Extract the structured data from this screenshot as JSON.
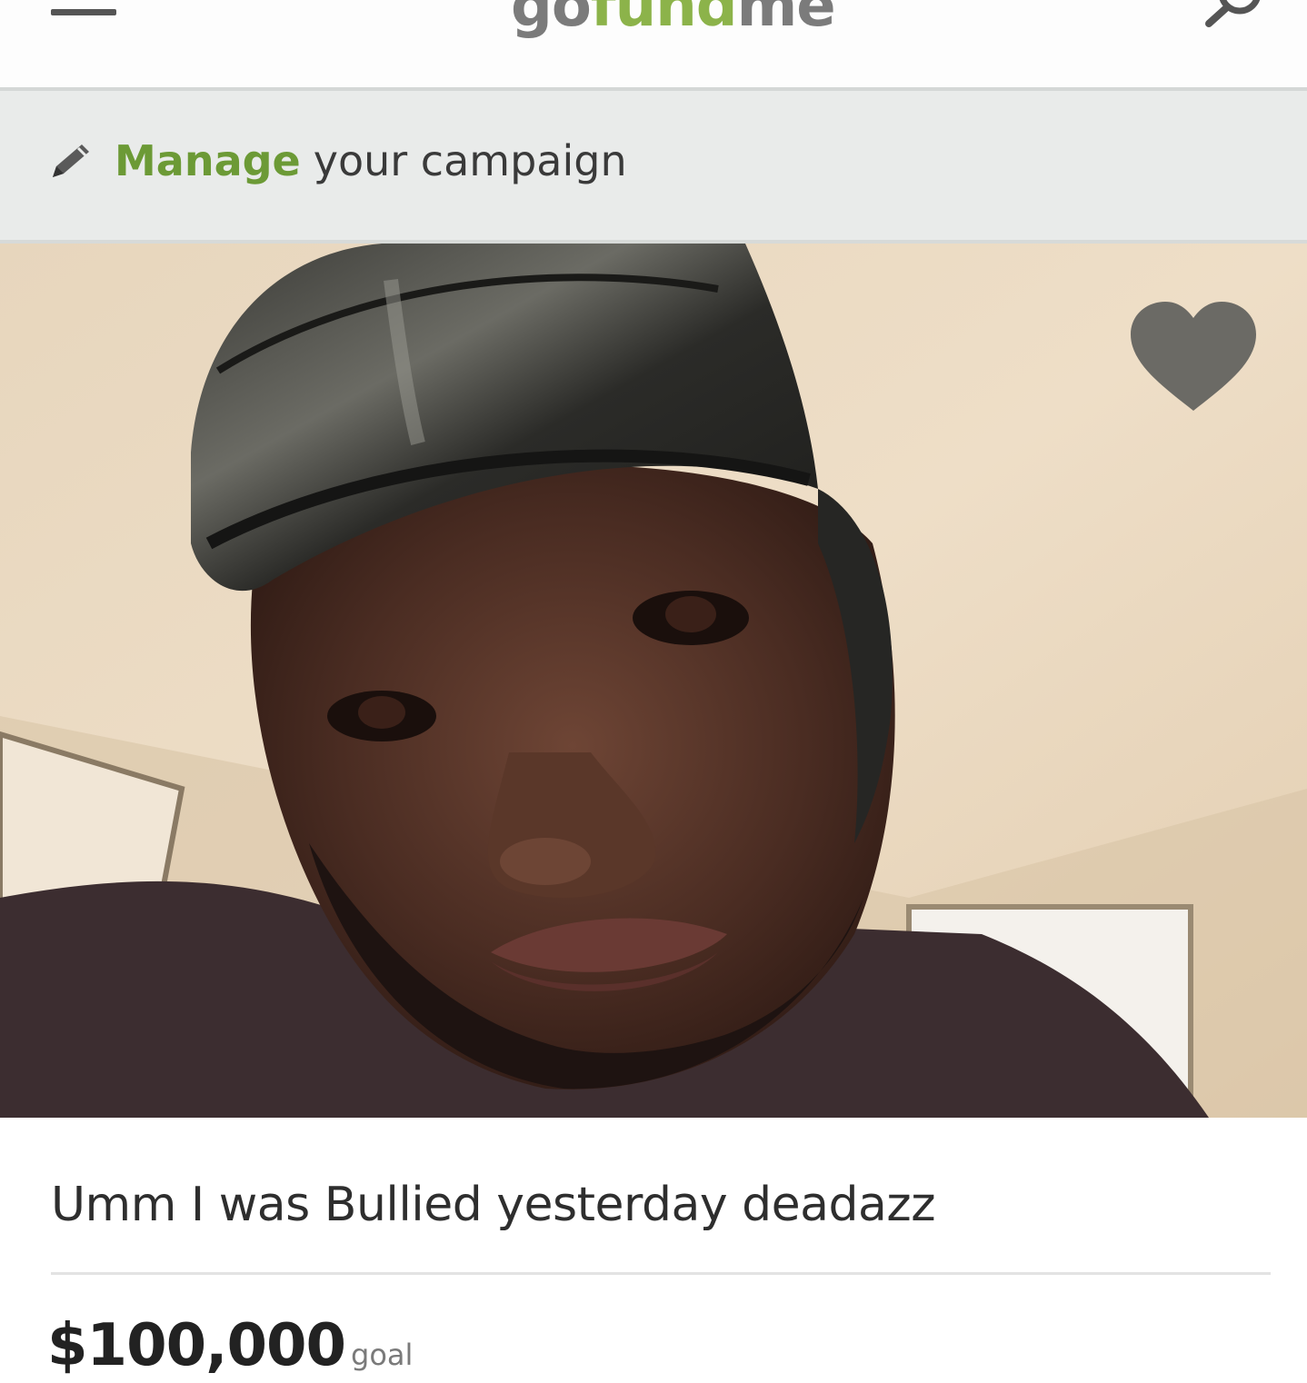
{
  "header": {
    "logo_go": "go",
    "logo_fund": "fund",
    "logo_me": "me",
    "menu_icon": "hamburger-menu-icon",
    "search_icon": "search-icon"
  },
  "manage": {
    "strong": "Manage",
    "rest": "your campaign",
    "icon": "pencil-icon"
  },
  "campaign": {
    "title": "Umm I was Bullied yesterday deadazz",
    "goal_amount": "$100,000",
    "goal_label": "goal",
    "favorite_icon": "heart-icon"
  },
  "colors": {
    "brand_green": "#6c9a36",
    "heart_gray": "#6b6a65"
  }
}
